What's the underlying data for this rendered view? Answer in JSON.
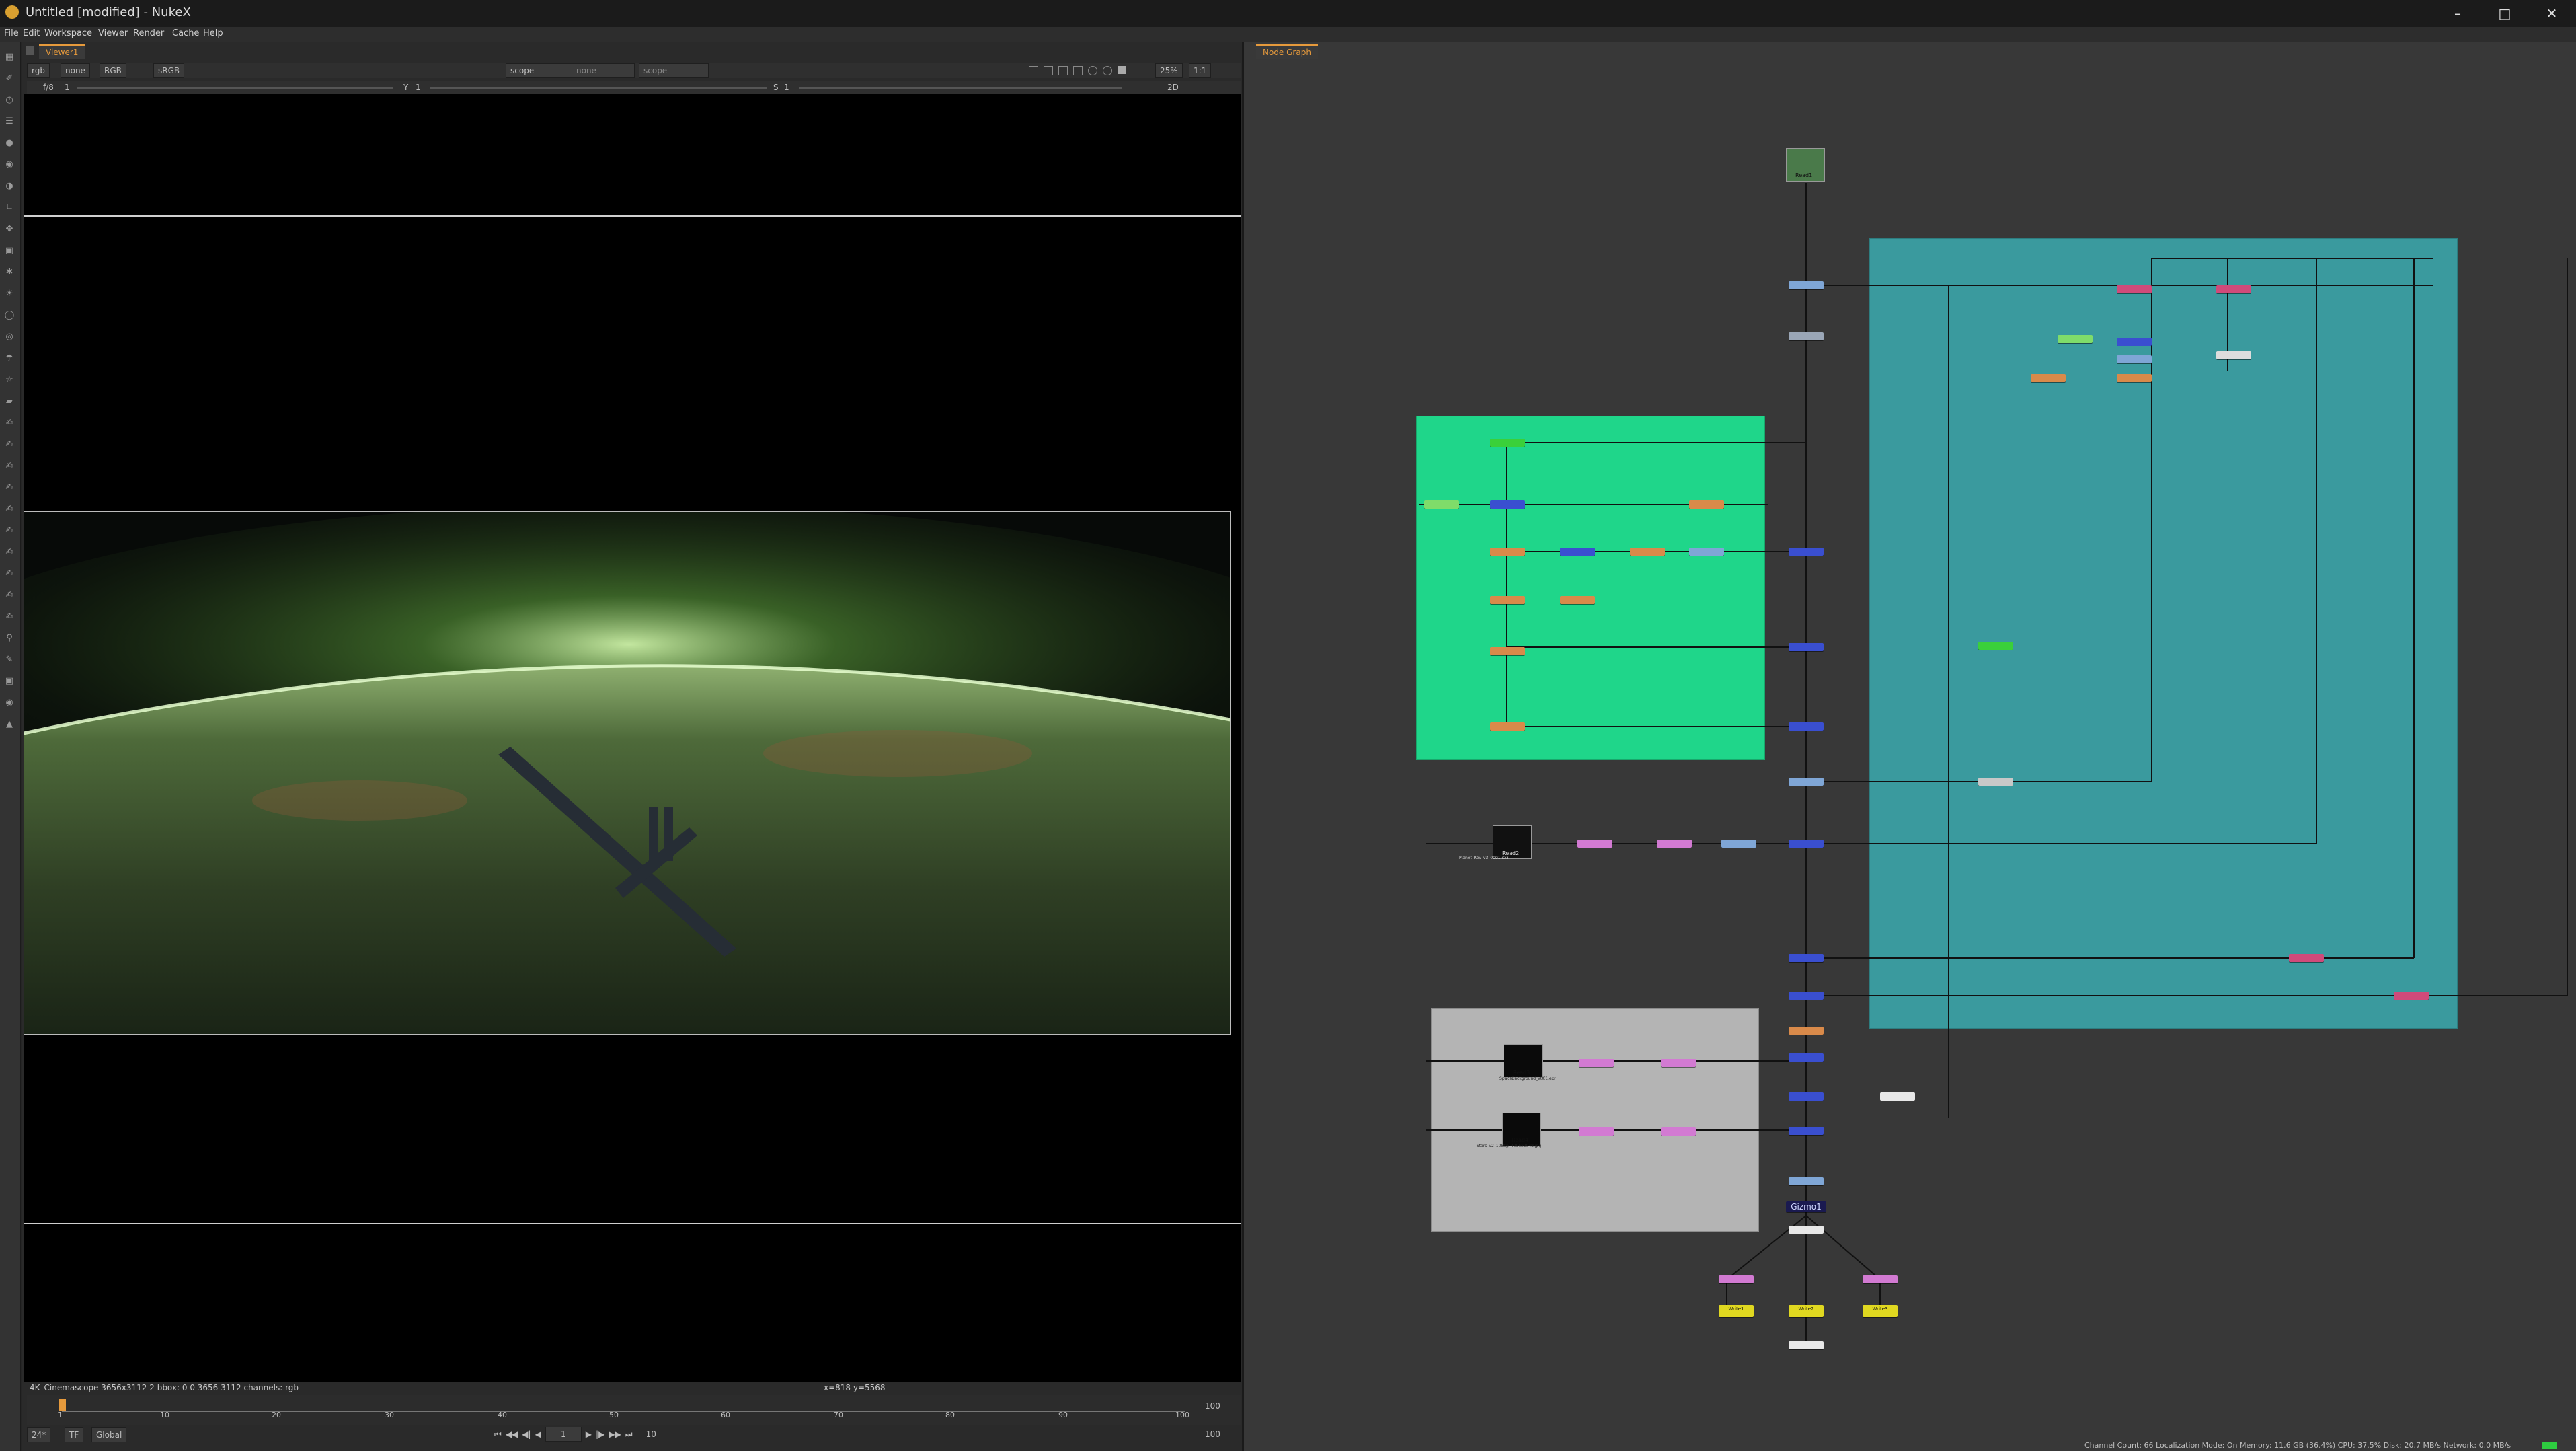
{
  "window": {
    "title": "Untitled [modified] - NukeX",
    "min": "–",
    "max": "□",
    "close": "✕"
  },
  "menu": [
    "File",
    "Edit",
    "Workspace",
    "Viewer",
    "Render",
    "Cache",
    "Help"
  ],
  "viewer": {
    "tab": "Viewer1",
    "channels": "rgb",
    "alpha": "none",
    "display": "RGB",
    "lut": "sRGB",
    "a_input": "scope",
    "wipe": "none",
    "b_input": "scope",
    "zoom": "25%",
    "ratio": "1:1",
    "mode": "2D",
    "fstop": "f/8",
    "frame_field": "1",
    "y_label": "Y",
    "y_value": "1",
    "s_label": "S",
    "s_value": "1",
    "format_info": "4K_Cinemascope 3656x3112 2   bbox: 0 0 3656 3112 channels: rgb",
    "coords": "x=818 y=5568"
  },
  "timeline": {
    "fps": "24*",
    "tf": "TF",
    "scope": "Global",
    "start": "1",
    "end": "100",
    "current": "1",
    "increment": "10",
    "ticks": [
      "1",
      "10",
      "20",
      "30",
      "40",
      "50",
      "60",
      "70",
      "80",
      "90",
      "100"
    ]
  },
  "nodegraph": {
    "tab": "Node Graph",
    "gizmo": "Gizmo1",
    "read_labels": [
      "Read1",
      "Read2",
      "Read3",
      "Read4"
    ],
    "read2_caption": "Planet_Rev_v3_0001.exr",
    "read3_caption": "SpaceBackground_v001.exr",
    "read4_caption": "Stars_v2_1080p_4096x2048.jpg",
    "write_labels": [
      "Write1",
      "Write2",
      "Write3"
    ]
  },
  "status": "Channel Count: 66  Localization Mode: On  Memory: 11.6 GB (36.4%)  CPU: 37.5%  Disk: 20.7 MB/s  Network: 0.0 MB/s",
  "colors": {
    "accent": "#e69a3c",
    "teal_backdrop": "#3a9a9e",
    "green_backdrop": "#1fd68a",
    "gray_backdrop": "#b4b4b4"
  }
}
